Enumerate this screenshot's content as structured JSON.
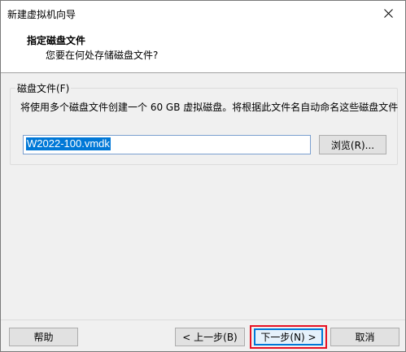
{
  "window": {
    "title": "新建虚拟机向导"
  },
  "header": {
    "title": "指定磁盘文件",
    "subtitle": "您要在何处存储磁盘文件?"
  },
  "disk_group": {
    "label": "磁盘文件(F)",
    "description": "将使用多个磁盘文件创建一个 60 GB 虚拟磁盘。将根据此文件名自动命名这些磁盘文件",
    "file_value": "W2022-100.vmdk",
    "browse_label": "浏览(R)..."
  },
  "footer": {
    "help_label": "帮助",
    "back_label": "< 上一步(B)",
    "next_label": "下一步(N) >",
    "cancel_label": "取消"
  },
  "colors": {
    "selection": "#0078d7",
    "highlight_border": "#e81123",
    "window_bg": "#f0f0f0"
  },
  "icons": {
    "close": "close-icon"
  }
}
